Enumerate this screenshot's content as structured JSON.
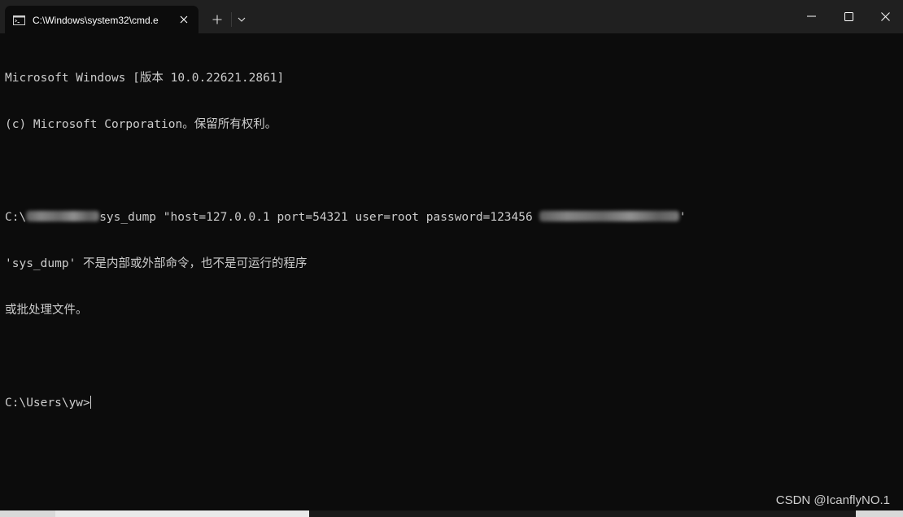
{
  "window": {
    "tab_title": "C:\\Windows\\system32\\cmd.e",
    "icons": {
      "tab": "terminal-icon",
      "close_tab": "close-icon",
      "new_tab": "plus-icon",
      "dropdown": "chevron-down-icon",
      "minimize": "minimize-icon",
      "maximize": "maximize-icon",
      "close": "close-icon"
    }
  },
  "terminal": {
    "line1": "Microsoft Windows [版本 10.0.22621.2861]",
    "line2": "(c) Microsoft Corporation。保留所有权利。",
    "cmd_prefix": "C:\\",
    "cmd_text": "sys_dump \"host=127.0.0.1 port=54321 user=root password=123456",
    "cmd_suffix": "'",
    "error_line1": "'sys_dump' 不是内部或外部命令，也不是可运行的程序",
    "error_line2": "或批处理文件。",
    "prompt": "C:\\Users\\yw>"
  },
  "watermark": "CSDN @IcanflyNO.1",
  "colors": {
    "background": "#0c0c0c",
    "titlebar": "#202020",
    "text": "#cccccc"
  }
}
